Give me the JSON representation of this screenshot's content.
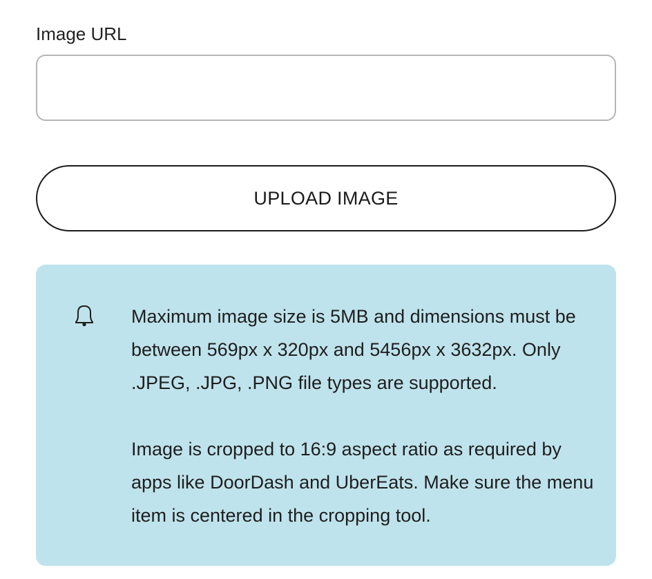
{
  "image_url": {
    "label": "Image URL",
    "value": "",
    "placeholder": ""
  },
  "upload": {
    "label": "UPLOAD IMAGE"
  },
  "notice": {
    "icon": "bell-icon",
    "background_color": "#bfe3ec",
    "paragraph_1": "Maximum image size is 5MB and dimensions must be between 569px x 320px and 5456px x 3632px. Only .JPEG, .JPG, .PNG file types are supported.",
    "paragraph_2": "Image is cropped to 16:9 aspect ratio as required by apps like DoorDash and UberEats. Make sure the menu item is centered in the cropping tool."
  }
}
